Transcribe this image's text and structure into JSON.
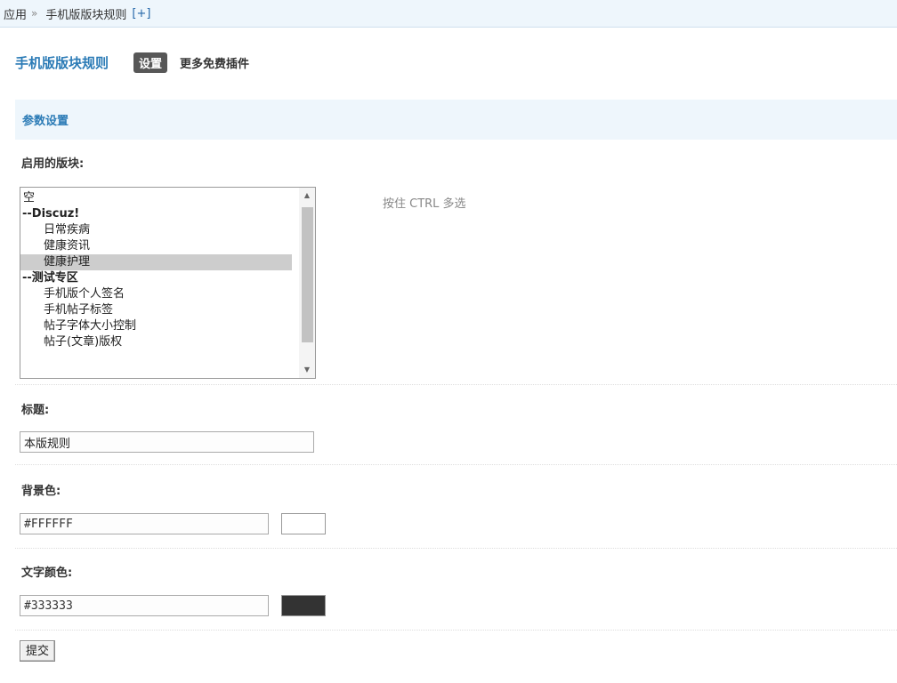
{
  "breadcrumb": {
    "app": "应用",
    "separator": "»",
    "plugin": "手机版版块规则",
    "add": "[+]"
  },
  "header": {
    "title": "手机版版块规则",
    "tab_current": "设置",
    "tab_more": "更多免费插件"
  },
  "section": {
    "title": "参数设置"
  },
  "forums": {
    "label": "启用的版块:",
    "hint": "按住 CTRL 多选",
    "options": [
      {
        "label": "空",
        "kind": "first",
        "selected": false
      },
      {
        "label": "--Discuz!",
        "kind": "group",
        "selected": false
      },
      {
        "label": "日常疾病",
        "kind": "item",
        "selected": false
      },
      {
        "label": "健康资讯",
        "kind": "item",
        "selected": false
      },
      {
        "label": "健康护理",
        "kind": "item",
        "selected": true
      },
      {
        "label": "--测试专区",
        "kind": "group",
        "selected": false
      },
      {
        "label": "手机版个人签名",
        "kind": "item",
        "selected": false
      },
      {
        "label": "手机帖子标签",
        "kind": "item",
        "selected": false
      },
      {
        "label": "帖子字体大小控制",
        "kind": "item",
        "selected": false
      },
      {
        "label": "帖子(文章)版权",
        "kind": "item",
        "selected": false
      }
    ]
  },
  "title_field": {
    "label": "标题:",
    "value": "本版规则"
  },
  "bgcolor": {
    "label": "背景色:",
    "value": "#FFFFFF",
    "swatch": "#ffffff"
  },
  "textcolor": {
    "label": "文字颜色:",
    "value": "#333333",
    "swatch": "#333333"
  },
  "submit": {
    "label": "提交"
  },
  "colors": {
    "accent": "#2b7bb6",
    "header_bg": "#eef6fc",
    "tab_bg": "#575757"
  }
}
